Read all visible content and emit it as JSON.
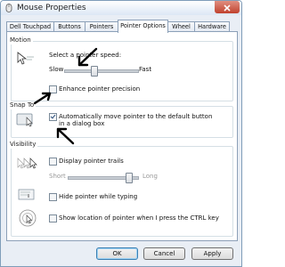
{
  "window": {
    "title": "Mouse Properties"
  },
  "tabs": [
    {
      "label": "Dell Touchpad"
    },
    {
      "label": "Buttons"
    },
    {
      "label": "Pointers"
    },
    {
      "label": "Pointer Options"
    },
    {
      "label": "Wheel"
    },
    {
      "label": "Hardware"
    }
  ],
  "active_tab": "Pointer Options",
  "motion": {
    "group_label": "Motion",
    "speed_label": "Select a pointer speed:",
    "slow_label": "Slow",
    "fast_label": "Fast",
    "speed_level": 0.4,
    "precision_label": "Enhance pointer precision",
    "precision_checked": false
  },
  "snap": {
    "group_label": "Snap To",
    "auto_move_label": "Automatically move pointer to the default button in a dialog box",
    "auto_move_checked": true
  },
  "visibility": {
    "group_label": "Visibility",
    "trails_label": "Display pointer trails",
    "trails_checked": false,
    "short_label": "Short",
    "long_label": "Long",
    "trail_length": 0.9,
    "hide_label": "Hide pointer while typing",
    "hide_checked": false,
    "ctrl_label": "Show location of pointer when I press the CTRL key",
    "ctrl_checked": false
  },
  "buttons": {
    "ok": "OK",
    "cancel": "Cancel",
    "apply": "Apply"
  }
}
